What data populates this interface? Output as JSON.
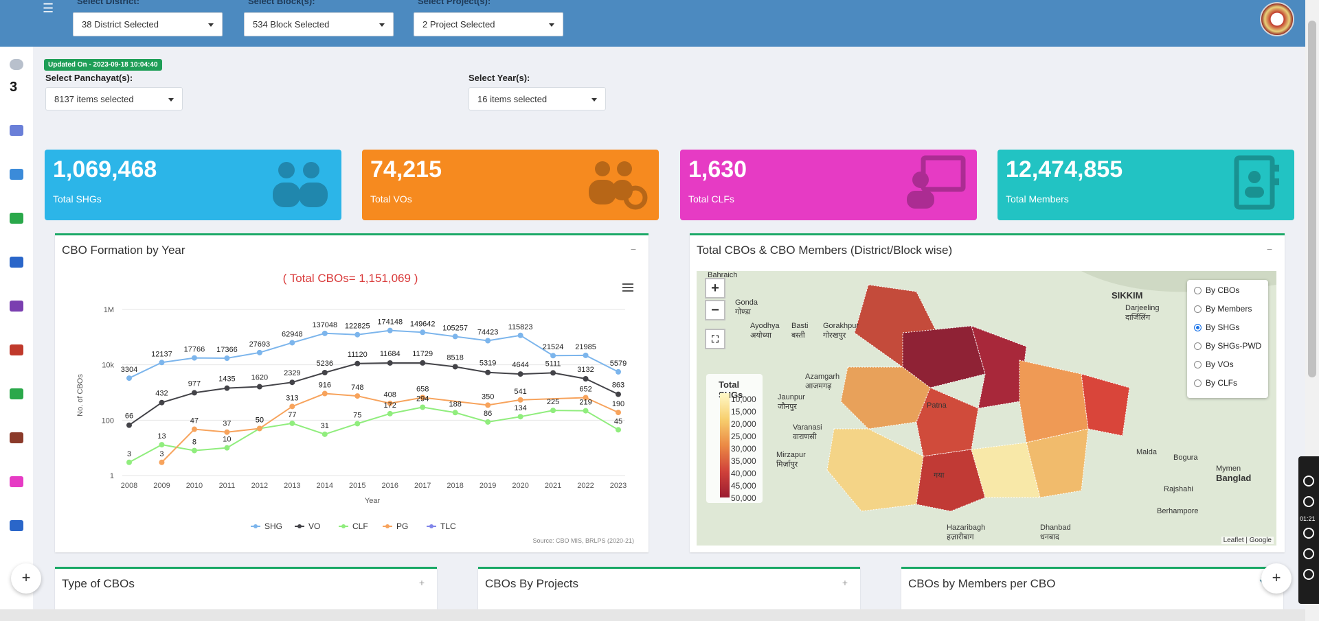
{
  "header": {
    "district": {
      "label": "Select District:",
      "value": "38 District Selected"
    },
    "block": {
      "label": "Select Block(s):",
      "value": "534 Block Selected"
    },
    "project": {
      "label": "Select Project(s):",
      "value": "2 Project Selected"
    }
  },
  "sidebar": {
    "count": "3"
  },
  "filters": {
    "updated": "Updated On - 2023-09-18 10:04:40",
    "panchayat": {
      "label": "Select Panchayat(s):",
      "value": "8137 items selected"
    },
    "year": {
      "label": "Select Year(s):",
      "value": "16 items selected"
    }
  },
  "stats": [
    {
      "value": "1,069,468",
      "label": "Total SHGs",
      "color": "#2cb5e8"
    },
    {
      "value": "74,215",
      "label": "Total VOs",
      "color": "#f68a1f"
    },
    {
      "value": "1,630",
      "label": "Total CLFs",
      "color": "#e63bc4"
    },
    {
      "value": "12,474,855",
      "label": "Total Members",
      "color": "#22c3c3"
    }
  ],
  "cbo_panel": {
    "title": "CBO Formation by Year",
    "collapse": "−"
  },
  "map_panel": {
    "title": "Total CBOs & CBO Members (District/Block wise)",
    "collapse": "−",
    "legend_title": "Total SHGs",
    "legend_ticks": [
      "10,000",
      "15,000",
      "20,000",
      "25,000",
      "30,000",
      "35,000",
      "40,000",
      "45,000",
      "50,000"
    ],
    "options": [
      "By CBOs",
      "By Members",
      "By SHGs",
      "By SHGs-PWD",
      "By VOs",
      "By CLFs"
    ],
    "selected_option": "By SHGs",
    "attribution": "Leaflet | Google",
    "places": [
      {
        "name": "Bahraich"
      },
      {
        "name": "Gonda\nगोण्डा"
      },
      {
        "name": "Ayodhya\nअयोध्या"
      },
      {
        "name": "Basti\nबस्ती"
      },
      {
        "name": "Gorakhpur\nगोरखपुर"
      },
      {
        "name": "Azamgarh\nआजमगढ़"
      },
      {
        "name": "Jaunpur\nजौनपुर"
      },
      {
        "name": "Varanasi\nवाराणसी"
      },
      {
        "name": "Mirzapur\nमिर्ज़ापुर"
      },
      {
        "name": "SIKKIM"
      },
      {
        "name": "Darjeeling\nदार्जिलिंग"
      },
      {
        "name": "Hazaribagh\nहज़ारीबाग"
      },
      {
        "name": "Dhanbad\nधनबाद"
      },
      {
        "name": "Malda"
      },
      {
        "name": "Bogura"
      },
      {
        "name": "Rajshahi"
      },
      {
        "name": "Berhampore"
      },
      {
        "name": "Banglad"
      },
      {
        "name": "Mymen"
      },
      {
        "name": "Patna"
      },
      {
        "name": "गया"
      }
    ]
  },
  "bottom_panels": [
    {
      "title": "Type of CBOs",
      "btn": "+"
    },
    {
      "title": "CBOs By Projects",
      "btn": "+"
    },
    {
      "title": "CBOs by Members per CBO",
      "btn": "🔧"
    }
  ],
  "recorder": {
    "time": "01:21"
  },
  "chart_data": {
    "type": "line",
    "title": "( Total CBOs= 1,151,069 )",
    "xlabel": "Year",
    "ylabel": "No. of CBOs",
    "yscale": "log",
    "ylim": [
      1,
      1000000
    ],
    "yticks": [
      "1",
      "100",
      "10k",
      "1M"
    ],
    "categories": [
      "2008",
      "2009",
      "2010",
      "2011",
      "2012",
      "2013",
      "2014",
      "2015",
      "2016",
      "2017",
      "2018",
      "2019",
      "2020",
      "2021",
      "2022",
      "2023"
    ],
    "series": [
      {
        "name": "SHG",
        "color": "#7cb5ec",
        "values": [
          3304,
          12137,
          17766,
          17366,
          27693,
          62948,
          137048,
          122825,
          174148,
          149642,
          105257,
          74423,
          115823,
          21524,
          21985,
          5579
        ]
      },
      {
        "name": "VO",
        "color": "#434348",
        "values": [
          66,
          432,
          977,
          1435,
          1620,
          2329,
          5236,
          11120,
          11684,
          11729,
          8518,
          5319,
          4644,
          5111,
          3132,
          863
        ]
      },
      {
        "name": "CLF",
        "color": "#90ed7d",
        "values": [
          3,
          13,
          8,
          10,
          50,
          77,
          31,
          75,
          172,
          294,
          188,
          86,
          134,
          225,
          219,
          45
        ]
      },
      {
        "name": "PG",
        "color": "#f7a35c",
        "values": [
          null,
          3,
          47,
          37,
          50,
          313,
          916,
          748,
          408,
          658,
          null,
          350,
          541,
          null,
          652,
          190
        ]
      },
      {
        "name": "TLC",
        "color": "#8085e9",
        "values": []
      }
    ],
    "legend": "bottom",
    "source": "Source: CBO MIS, BRLPS (2020-21)"
  }
}
